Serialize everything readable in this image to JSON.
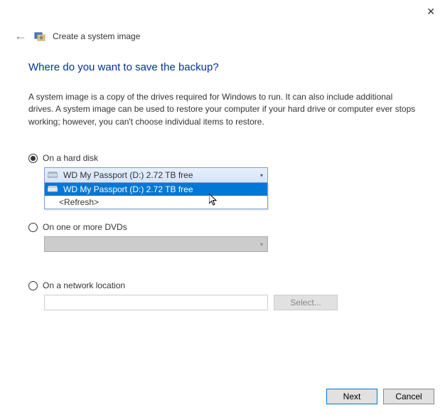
{
  "window": {
    "title": "Create a system image"
  },
  "content": {
    "heading": "Where do you want to save the backup?",
    "description": "A system image is a copy of the drives required for Windows to run. It can also include additional drives. A system image can be used to restore your computer if your hard drive or computer ever stops working; however, you can't choose individual items to restore."
  },
  "options": {
    "hard_disk": {
      "label": "On a hard disk",
      "selected_value": "WD My Passport (D:)  2.72 TB free",
      "dropdown": {
        "items": [
          "WD My Passport (D:)  2.72 TB free",
          "<Refresh>"
        ]
      }
    },
    "dvd": {
      "label": "On one or more DVDs"
    },
    "network": {
      "label": "On a network location",
      "select_button": "Select..."
    }
  },
  "footer": {
    "next": "Next",
    "cancel": "Cancel"
  }
}
